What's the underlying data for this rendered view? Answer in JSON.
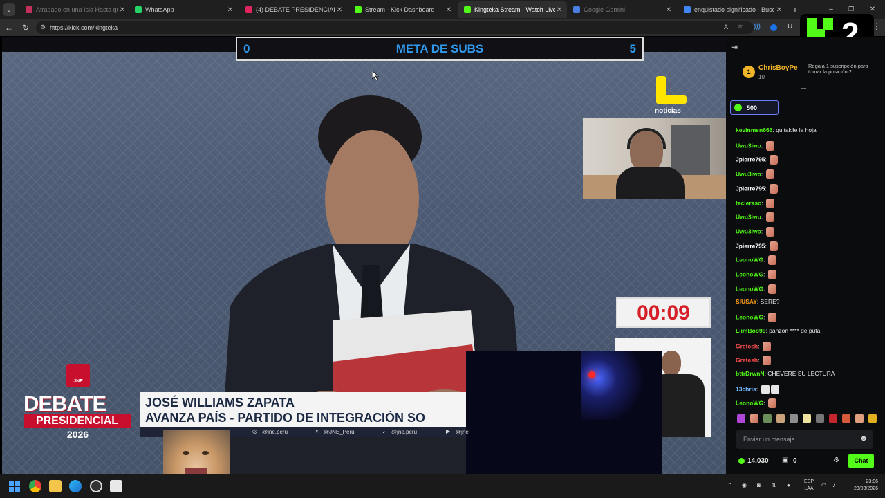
{
  "browser": {
    "tabs": [
      {
        "title": "Atrapado en una Isla Hasta que C",
        "state": "dim",
        "favicon_color": "#c4305c"
      },
      {
        "title": "WhatsApp",
        "state": "normal",
        "favicon_color": "#25d366"
      },
      {
        "title": "(4) DEBATE PRESIDENCIAL PE",
        "state": "normal",
        "favicon_color": "#e0245e"
      },
      {
        "title": "Stream - Kick Dashboard",
        "state": "normal",
        "favicon_color": "#53fc18"
      },
      {
        "title": "Kingteka Stream - Watch Live",
        "state": "active",
        "favicon_color": "#53fc18"
      },
      {
        "title": "Google Gemini",
        "state": "dim",
        "favicon_color": "#4a7ee0"
      },
      {
        "title": "enquistado significado - Buscar co",
        "state": "normal",
        "favicon_color": "#4285f4"
      }
    ],
    "new_tab_icon": "plus-icon",
    "url": "https://kick.com/kingteka",
    "window_controls": [
      "minimize-icon",
      "restore-icon",
      "close-icon"
    ]
  },
  "stream": {
    "meta_subs": {
      "label": "META DE SUBS",
      "current": "0",
      "goal": "5"
    },
    "channel_logo_text": "noticias",
    "timer": "00:09",
    "debate_logo": {
      "org": "JNE",
      "line1": "DEBATE",
      "line2": "PRESIDENCIAL",
      "year": "2026"
    },
    "lower_third": {
      "name": "JOSÉ WILLIAMS ZAPATA",
      "party": "AVANZA PAÍS - PARTIDO DE INTEGRACIÓN SO",
      "socials": [
        "@jne.peru",
        "@JNE_Peru",
        "@jne.peru",
        "@jne"
      ]
    },
    "overlay_k2": "2",
    "accent_color": "#53fc18"
  },
  "chat": {
    "leaderboard": {
      "rank": "1",
      "user": "ChrisBoyPe",
      "count": "10",
      "cta": "Regala 1 suscripción para tomar la posición 2"
    },
    "points_badge": "500",
    "messages": [
      {
        "user": "kevinmsn666",
        "text": "quitaklle la hoja",
        "color": "#53fc18",
        "emotes": 0
      },
      {
        "user": "Uwu3iwo",
        "text": "",
        "color": "#53fc18",
        "emotes": 1
      },
      {
        "user": "Jpierre795",
        "text": "",
        "color": "#ffffff",
        "emotes": 1
      },
      {
        "user": "Uwu3iwo",
        "text": "",
        "color": "#53fc18",
        "emotes": 1
      },
      {
        "user": "Jpierre795",
        "text": "",
        "color": "#ffffff",
        "emotes": 1
      },
      {
        "user": "tecleraso",
        "text": "",
        "color": "#53fc18",
        "emotes": 1
      },
      {
        "user": "Uwu3iwo",
        "text": "",
        "color": "#53fc18",
        "emotes": 1
      },
      {
        "user": "Uwu3iwo",
        "text": "",
        "color": "#53fc18",
        "emotes": 1
      },
      {
        "user": "Jpierre795",
        "text": "",
        "color": "#ffffff",
        "emotes": 1
      },
      {
        "user": "LeonoWG",
        "text": "",
        "color": "#53fc18",
        "emotes": 1
      },
      {
        "user": "LeonoWG",
        "text": "",
        "color": "#53fc18",
        "emotes": 1
      },
      {
        "user": "LeonoWG",
        "text": "",
        "color": "#53fc18",
        "emotes": 1
      },
      {
        "user": "SIUSAY",
        "text": "SERE?",
        "color": "#ff9f1a",
        "emotes": 0
      },
      {
        "user": "LeonoWG",
        "text": "",
        "color": "#53fc18",
        "emotes": 1
      },
      {
        "user": "LiimBoo99",
        "text": "panzon **** de puta",
        "color": "#53fc18",
        "emotes": 0
      },
      {
        "user": "Gretesh",
        "text": "",
        "color": "#ff4d4d",
        "emotes": 1
      },
      {
        "user": "Gretesh",
        "text": "",
        "color": "#ff4d4d",
        "emotes": 1
      },
      {
        "user": "bttrDrwnN",
        "text": "CHÉVERE SU LECTURA",
        "color": "#53fc18",
        "emotes": 0
      },
      {
        "user": "13chris",
        "text": "",
        "color": "#6fb7ff",
        "emotes": 2
      },
      {
        "user": "LeonoWG",
        "text": "",
        "color": "#53fc18",
        "emotes": 1
      }
    ],
    "input_placeholder": "Enviar un mensaje",
    "footer": {
      "points": "14.030",
      "gifts": "0",
      "send_label": "Chat"
    }
  },
  "taskbar": {
    "lang": "ESP",
    "layout": "LAA",
    "time": "23:06",
    "date": "23/03/2026"
  }
}
